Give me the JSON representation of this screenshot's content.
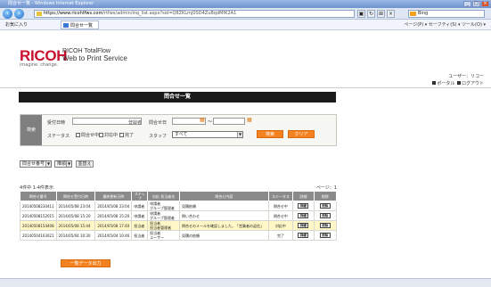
{
  "browser": {
    "window_title": "問合せ一覧 - Windows Internet Explorer",
    "url_domain": "https://www.ricohtfws.com",
    "url_rest": "/rtfws/admin/inq_list.aspx?sid=Q8ZKLmJ0SD4ZuBqdMfK2A1",
    "search_placeholder": "Bing",
    "favorites_label": "お気に入り",
    "tab_title": "問合せ一覧",
    "toolbar_items": "ページ(P) ▾  セーフティ(S) ▾  ツール(O) ▾"
  },
  "header": {
    "logo_text": "RICOH",
    "tagline": "imagine. change.",
    "product_line1": "RICOH TotalFlow",
    "product_line2": "Web to Print Service",
    "user_name": "ユーザー：リコー",
    "portal_link": "ポータル",
    "logout_link": "ログアウト"
  },
  "page_title": "問合せ一覧",
  "search": {
    "section_label": "検索",
    "inquiry_date_label": "受付日時",
    "requester_label": "登録者",
    "date_label": "問合せ日",
    "range_sep": "～",
    "status_label": "ステータス",
    "status_options": [
      "問合せ中",
      "対応中",
      "完了"
    ],
    "staff_label": "スタッフ",
    "staff_value": "すべて",
    "search_button": "検索",
    "clear_button": "クリア"
  },
  "sort": {
    "field_value": "問合せ番号",
    "order_value": "降順",
    "apply_button": "並替え"
  },
  "result_count": "4件中 1-4件表示",
  "pager": "ページ：1",
  "table": {
    "headers": [
      "問合せ番号",
      "問合せ受付日時",
      "最終更新日時",
      "ステップ",
      "対応\n担当者名",
      "問合せ内容",
      "ステータス",
      "詳細",
      "削除"
    ],
    "rows": [
      {
        "id": "20140508230411",
        "received": "2014/05/08 23:04",
        "updated": "2014/05/08 23:04",
        "step": "申請者",
        "staff": "申請者\nグループ管理者",
        "content": "見積依頼",
        "status": "問合せ中",
        "detail": "詳細",
        "delete": "削除"
      },
      {
        "id": "20140508152015",
        "received": "2014/05/08 15:20",
        "updated": "2014/05/08 15:20",
        "step": "申請者",
        "staff": "申請者\nグループ管理者",
        "content": "問い合わせ",
        "status": "問合せ中",
        "detail": "詳細",
        "delete": "削除"
      },
      {
        "id": "20140508154408",
        "received": "2014/05/08 15:44",
        "updated": "2014/05/08 17:40",
        "step": "担当者",
        "staff": "担当者\n担当者管理者",
        "content": "問合せのメールを確認しました。「営業者の返信」",
        "status": "対応中",
        "detail": "詳細",
        "delete": "削除"
      },
      {
        "id": "20140504103021",
        "received": "2014/05/04 10:30",
        "updated": "2014/05/04 10:46",
        "step": "担当者",
        "staff": "担当者\nユーザー",
        "content": "見積の依頼",
        "status": "完了",
        "detail": "詳細",
        "delete": "削除"
      }
    ]
  },
  "csv_button": "一覧データ出力",
  "colors": {
    "accent_orange": "#f58220",
    "brand_red": "#c8102e",
    "title_band": "#1a1a1a",
    "highlight_row": "#fff8c6"
  }
}
